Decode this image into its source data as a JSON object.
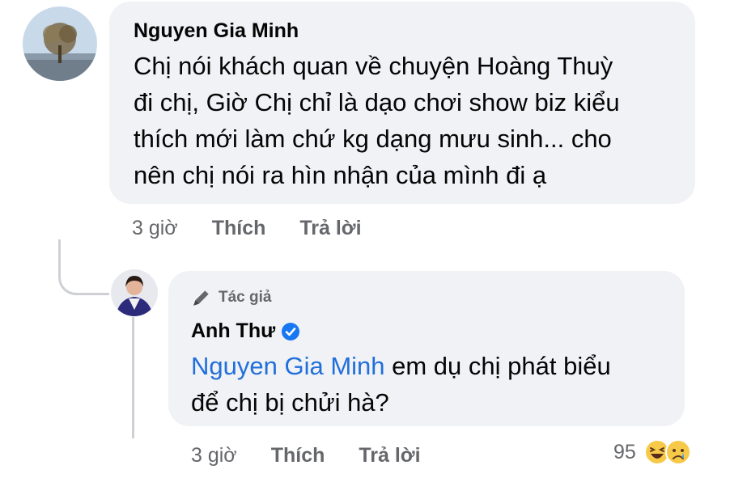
{
  "comment": {
    "author": "Nguyen Gia Minh",
    "text_lines": [
      "Chị nói khách quan về chuyện Hoàng Thuỳ",
      "đi chị, Giờ Chị chỉ là dạo chơi show biz kiểu",
      "thích mới làm chứ kg dạng mưu sinh... cho",
      "nên chị nói ra hìn nhận của mình đi ạ"
    ],
    "time": "3 giờ",
    "like_label": "Thích",
    "reply_label": "Trả lời"
  },
  "reply": {
    "author_badge": "Tác giả",
    "author": "Anh Thư",
    "mention": "Nguyen Gia Minh",
    "text_line1_rest": " em dụ chị phát biểu",
    "text_line2": "để chị bị chửi hà?",
    "time": "3 giờ",
    "like_label": "Thích",
    "reply_label": "Trả lời",
    "reaction_count": "95",
    "reactions": [
      "laughing-face-icon",
      "sad-face-icon"
    ]
  },
  "colors": {
    "bubble": "#f0f2f5",
    "mention": "#216fdb",
    "verified": "#1877f2",
    "secondary_text": "#65676b"
  }
}
